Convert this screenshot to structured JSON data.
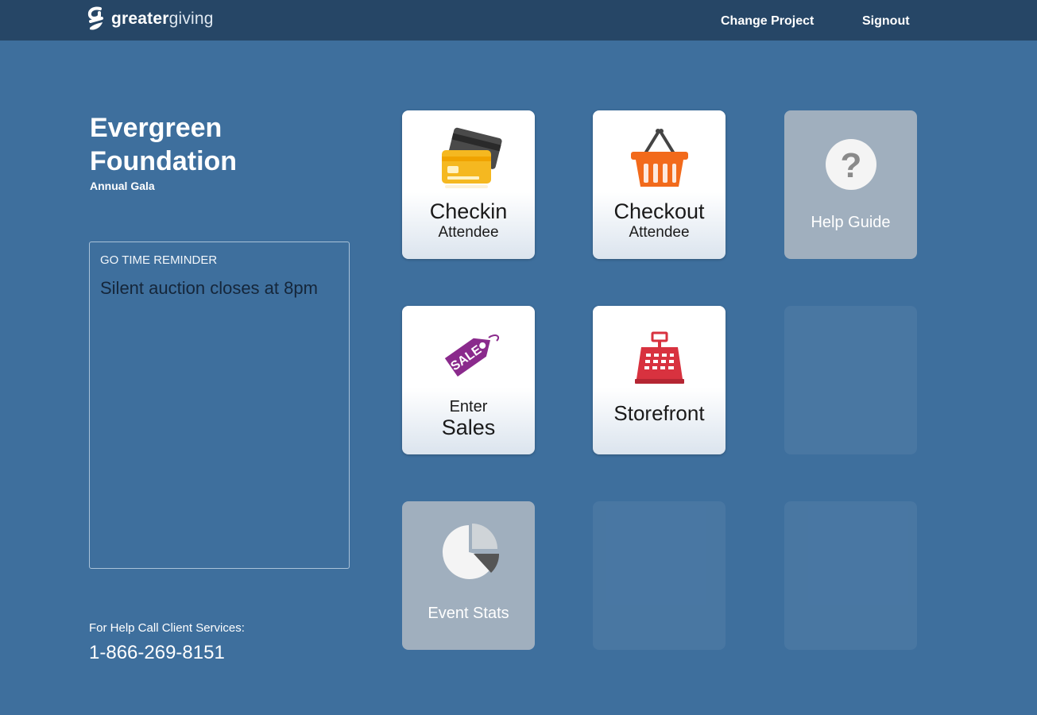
{
  "header": {
    "logo_bold": "greater",
    "logo_light": "giving",
    "change_project": "Change Project",
    "signout": "Signout"
  },
  "org": {
    "name_line1": "Evergreen",
    "name_line2": "Foundation",
    "event": "Annual Gala"
  },
  "reminder": {
    "title": "GO TIME REMINDER",
    "text": "Silent auction closes at 8pm"
  },
  "help": {
    "label": "For Help Call Client Services:",
    "phone": "1-866-269-8151"
  },
  "tiles": {
    "checkin": {
      "title": "Checkin",
      "subtitle": "Attendee"
    },
    "checkout": {
      "title": "Checkout",
      "subtitle": "Attendee"
    },
    "help_guide": {
      "title": "Help Guide"
    },
    "enter_sales": {
      "pre": "Enter",
      "title": "Sales",
      "tag_text": "SALE"
    },
    "storefront": {
      "title": "Storefront"
    },
    "event_stats": {
      "title": "Event Stats"
    }
  },
  "colors": {
    "background": "#3e6f9d",
    "topbar": "#264666",
    "card_icon": "#f5b820",
    "basket_icon": "#f26a1b",
    "sale_tag": "#8a2a8c",
    "register_icon": "#d8323f",
    "inactive_tile": "#a0afbe"
  }
}
